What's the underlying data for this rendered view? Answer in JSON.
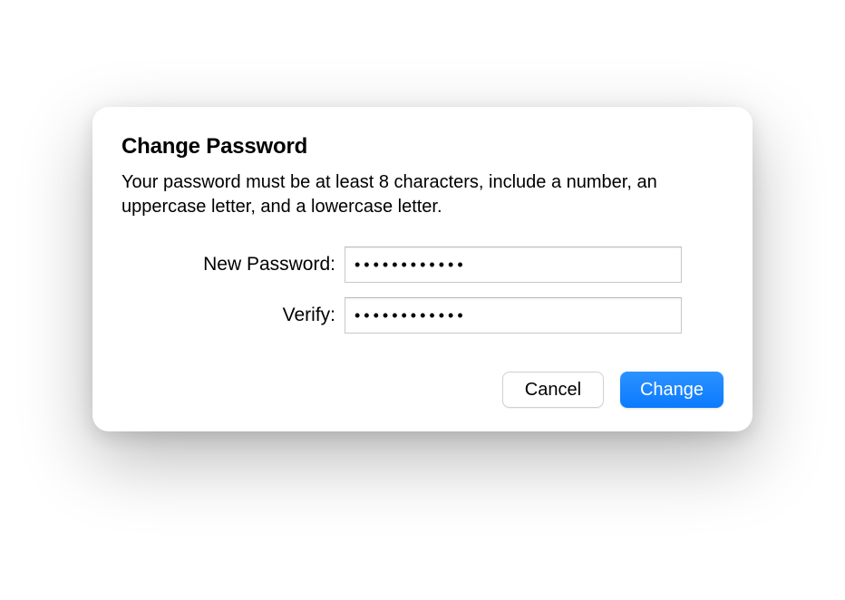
{
  "dialog": {
    "title": "Change Password",
    "description": "Your password must be at least 8 characters, include a number, an uppercase letter, and a lowercase letter.",
    "fields": {
      "new_password": {
        "label": "New Password:",
        "value": "●●●●●●●●●●●●"
      },
      "verify": {
        "label": "Verify:",
        "value": "●●●●●●●●●●●●"
      }
    },
    "buttons": {
      "cancel": "Cancel",
      "confirm": "Change"
    }
  }
}
